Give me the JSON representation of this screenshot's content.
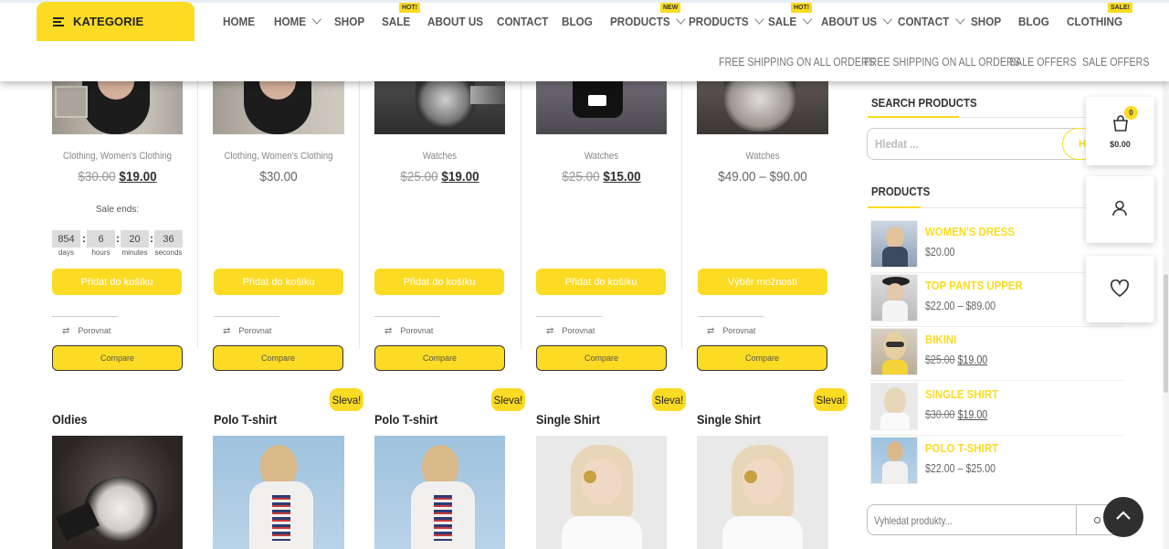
{
  "header": {
    "category_button": "KATEGORIE",
    "nav": [
      {
        "label": "HOME",
        "dropdown": false,
        "badge": ""
      },
      {
        "label": "HOME",
        "dropdown": true,
        "badge": ""
      },
      {
        "label": "SHOP",
        "dropdown": false,
        "badge": ""
      },
      {
        "label": "SALE",
        "dropdown": false,
        "badge": "HOT!"
      },
      {
        "label": "ABOUT US",
        "dropdown": false,
        "badge": ""
      },
      {
        "label": "CONTACT",
        "dropdown": false,
        "badge": ""
      },
      {
        "label": "BLOG",
        "dropdown": false,
        "badge": ""
      },
      {
        "label": "PRODUCTS",
        "dropdown": true,
        "badge": "NEW"
      },
      {
        "label": "PRODUCTS",
        "dropdown": true,
        "badge": ""
      },
      {
        "label": "SALE",
        "dropdown": true,
        "badge": "HOT!"
      },
      {
        "label": "ABOUT US",
        "dropdown": true,
        "badge": ""
      },
      {
        "label": "CONTACT",
        "dropdown": true,
        "badge": ""
      },
      {
        "label": "SHOP",
        "dropdown": false,
        "badge": ""
      },
      {
        "label": "BLOG",
        "dropdown": false,
        "badge": ""
      },
      {
        "label": "CLOTHING",
        "dropdown": false,
        "badge": "SALE!"
      }
    ],
    "secondary_links": [
      "FREE SHIPPING ON ALL ORDERS",
      "FREE SHIPPING ON ALL ORDERS",
      "SALE OFFERS",
      "SALE OFFERS"
    ]
  },
  "products_row1": [
    {
      "categories": "Clothing,   Women's Clothing",
      "old_price": "$30.00",
      "price": "$19.00",
      "button": "Přidat do košíku",
      "compare_link": "Porovnat",
      "compare_button": "Compare"
    },
    {
      "categories": "Clothing,   Women's Clothing",
      "old_price": "",
      "price": "$30.00",
      "button": "Přidat do košíku",
      "compare_link": "Porovnat",
      "compare_button": "Compare"
    },
    {
      "categories": "Watches",
      "old_price": "$25.00",
      "price": "$19.00",
      "button": "Přidat do košíku",
      "compare_link": "Porovnat",
      "compare_button": "Compare"
    },
    {
      "categories": "Watches",
      "old_price": "$25.00",
      "price": "$15.00",
      "button": "Přidat do košíku",
      "compare_link": "Porovnat",
      "compare_button": "Compare"
    },
    {
      "categories": "Watches",
      "old_price": "",
      "price": "$49.00 – $90.00",
      "button": "Výběr možností",
      "compare_link": "Porovnat",
      "compare_button": "Compare"
    }
  ],
  "countdown": {
    "label": "Sale ends:",
    "values": [
      "854",
      "6",
      "20",
      "36"
    ],
    "units": [
      "days",
      "hours",
      "minutes",
      "seconds"
    ]
  },
  "products_row2": [
    {
      "title": "Oldies",
      "badge": ""
    },
    {
      "title": "Polo T-shirt",
      "badge": "Sleva!"
    },
    {
      "title": "Polo T-shirt",
      "badge": "Sleva!"
    },
    {
      "title": "Single Shirt",
      "badge": "Sleva!"
    },
    {
      "title": "Single Shirt",
      "badge": "Sleva!"
    }
  ],
  "sidebar": {
    "search_heading": "SEARCH PRODUCTS",
    "search_placeholder": "Hledat ...",
    "search_button": "HL",
    "products_heading": "PRODUCTS",
    "products": [
      {
        "name": "WOMEN'S DRESS",
        "old_price": "",
        "price": "$20.00"
      },
      {
        "name": "TOP PANTS UPPER",
        "old_price": "",
        "price": "$22.00 – $89.00"
      },
      {
        "name": "BIKINI",
        "old_price": "$25.00",
        "price": "$19.00"
      },
      {
        "name": "SINGLE SHIRT",
        "old_price": "$30.00",
        "price": "$19.00"
      },
      {
        "name": "POLO T-SHIRT",
        "old_price": "",
        "price": "$22.00 – $25.00"
      }
    ],
    "bottom_search_placeholder": "Vyhledat produkty..."
  },
  "floating": {
    "cart_count": "0",
    "cart_total": "$0.00"
  },
  "colors": {
    "accent": "#fbdb23",
    "dark": "#222222"
  }
}
